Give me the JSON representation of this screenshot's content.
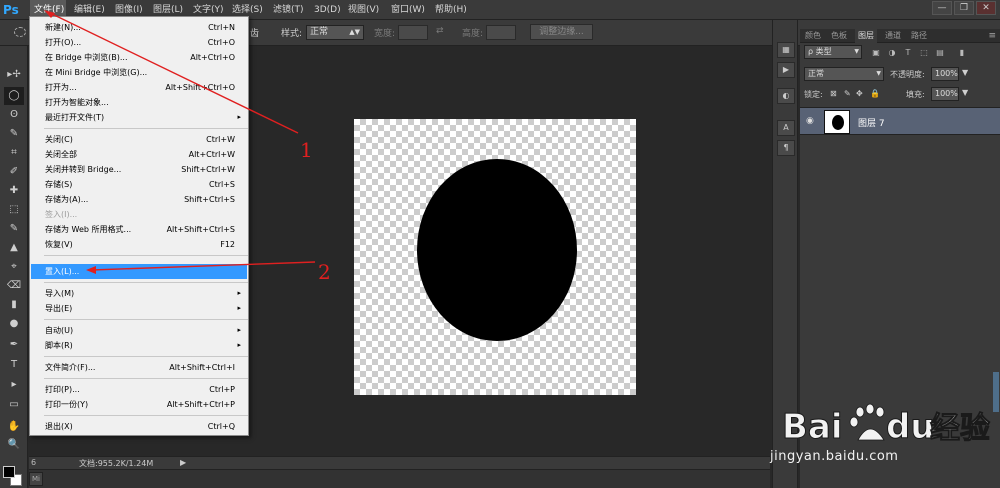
{
  "app": {
    "logo": "Ps"
  },
  "menubar": {
    "items": [
      {
        "label": "文件(F)"
      },
      {
        "label": "编辑(E)"
      },
      {
        "label": "图像(I)"
      },
      {
        "label": "图层(L)"
      },
      {
        "label": "文字(Y)"
      },
      {
        "label": "选择(S)"
      },
      {
        "label": "滤镜(T)"
      },
      {
        "label": "3D(D)"
      },
      {
        "label": "视图(V)"
      },
      {
        "label": "窗口(W)"
      },
      {
        "label": "帮助(H)"
      }
    ],
    "window_controls": [
      "—",
      "❐",
      "✕"
    ]
  },
  "options_bar": {
    "partial_label": "齿",
    "style_label": "样式:",
    "style_value": "正常",
    "width_label": "宽度:",
    "height_label": "高度:",
    "refine_edge_button": "调整边缘..."
  },
  "file_menu": {
    "items": [
      {
        "label": "新建(N)...",
        "shortcut": "Ctrl+N"
      },
      {
        "label": "打开(O)...",
        "shortcut": "Ctrl+O"
      },
      {
        "label": "在 Bridge 中浏览(B)...",
        "shortcut": "Alt+Ctrl+O"
      },
      {
        "label": "在 Mini Bridge 中浏览(G)...",
        "shortcut": ""
      },
      {
        "label": "打开为...",
        "shortcut": "Alt+Shift+Ctrl+O"
      },
      {
        "label": "打开为智能对象...",
        "shortcut": ""
      },
      {
        "label": "最近打开文件(T)",
        "shortcut": ""
      },
      {
        "label": "关闭(C)",
        "shortcut": "Ctrl+W"
      },
      {
        "label": "关闭全部",
        "shortcut": "Alt+Ctrl+W"
      },
      {
        "label": "关闭并转到 Bridge...",
        "shortcut": "Shift+Ctrl+W"
      },
      {
        "label": "存储(S)",
        "shortcut": "Ctrl+S"
      },
      {
        "label": "存储为(A)...",
        "shortcut": "Shift+Ctrl+S"
      },
      {
        "label": "签入(I)...",
        "shortcut": ""
      },
      {
        "label": "存储为 Web 所用格式...",
        "shortcut": "Alt+Shift+Ctrl+S"
      },
      {
        "label": "恢复(V)",
        "shortcut": "F12"
      },
      {
        "label": "置入(L)...",
        "shortcut": ""
      },
      {
        "label": "导入(M)",
        "shortcut": ""
      },
      {
        "label": "导出(E)",
        "shortcut": ""
      },
      {
        "label": "自动(U)",
        "shortcut": ""
      },
      {
        "label": "脚本(R)",
        "shortcut": ""
      },
      {
        "label": "文件简介(F)...",
        "shortcut": "Alt+Shift+Ctrl+I"
      },
      {
        "label": "打印(P)...",
        "shortcut": "Ctrl+P"
      },
      {
        "label": "打印一份(Y)",
        "shortcut": "Alt+Shift+Ctrl+P"
      },
      {
        "label": "退出(X)",
        "shortcut": "Ctrl+Q"
      }
    ],
    "submenu_glyph": "▸"
  },
  "tools": {
    "icons": [
      "▸✢",
      "◯",
      "ʘ",
      "✎",
      "⌗",
      "✐",
      "✚",
      "⬚",
      "✎",
      "▲",
      "⌖",
      "⌫",
      "▮",
      "●",
      "✋",
      "✒",
      "T",
      "▸",
      "▭",
      "✋",
      "🔍"
    ]
  },
  "status": {
    "zoom": "6",
    "doc_info": "文档:955.2K/1.24M",
    "arrow": "▶",
    "mini_bridge": "Mi"
  },
  "panel": {
    "tabs": [
      {
        "label": "颜色"
      },
      {
        "label": "色板"
      },
      {
        "label": "图层"
      },
      {
        "label": "通道"
      },
      {
        "label": "路径"
      }
    ],
    "menu_glyph": "≡",
    "filter_kind": "ρ 类型",
    "blend_mode": "正常",
    "opacity_label": "不透明度:",
    "opacity_value": "100%",
    "lock_label": "锁定:",
    "fill_label": "填充:",
    "fill_value": "100%",
    "layer": {
      "name": "图层 7",
      "eye": "👁"
    }
  },
  "annotations": {
    "label_1": "1",
    "label_2": "2"
  },
  "watermark": {
    "url": "jingyan.baidu.com"
  },
  "colors": {
    "highlight": "#3399ff",
    "annotation": "#e02020",
    "layer_selected": "#586275"
  }
}
